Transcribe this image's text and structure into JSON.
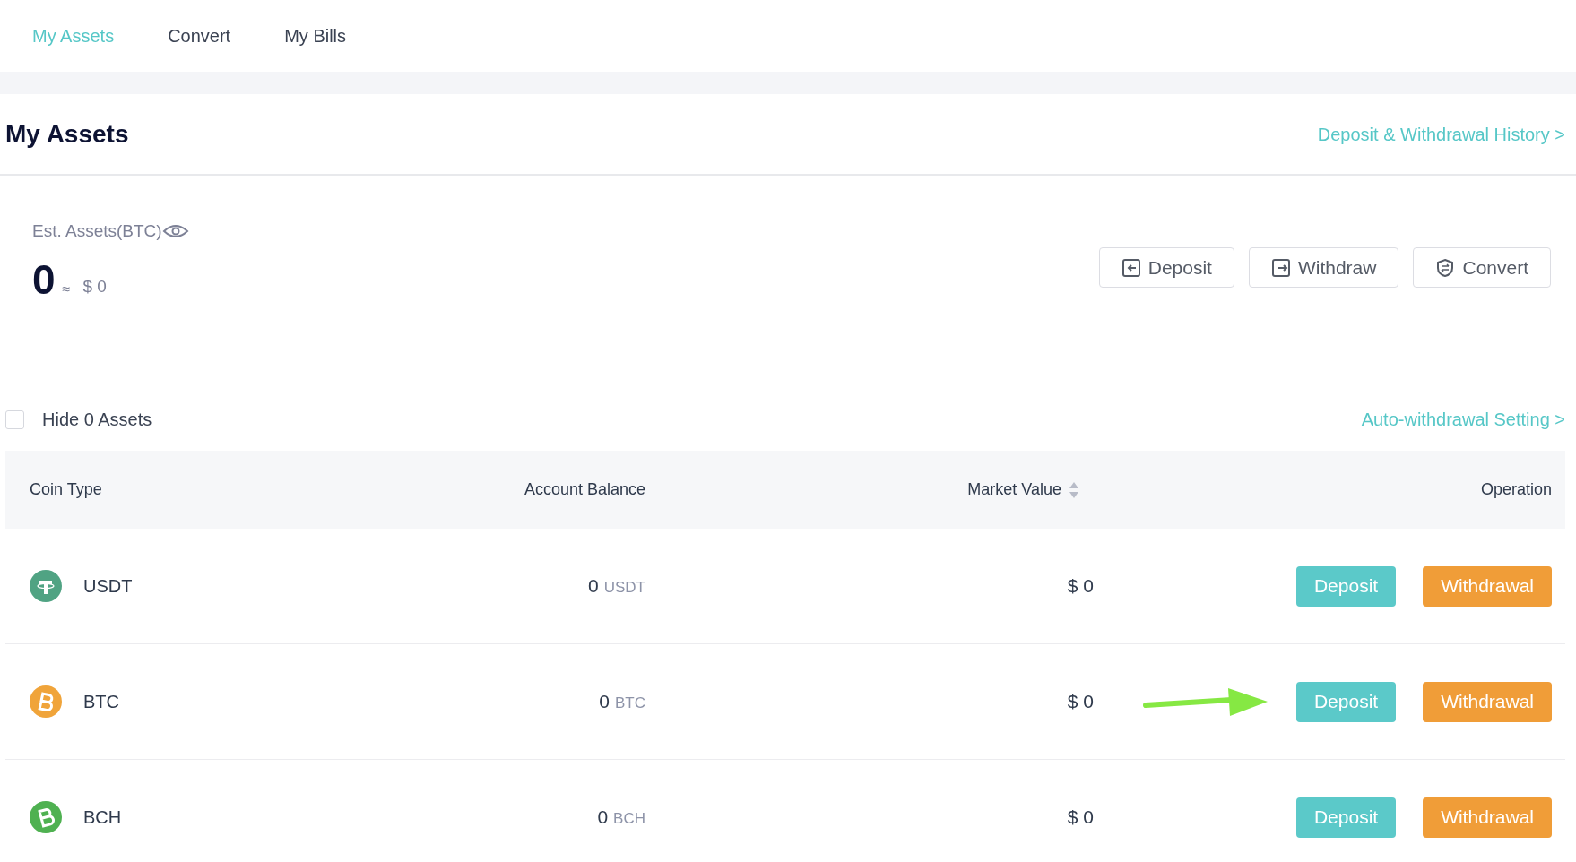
{
  "tabs": [
    {
      "label": "My Assets",
      "selected": true
    },
    {
      "label": "Convert",
      "selected": false
    },
    {
      "label": "My Bills",
      "selected": false
    }
  ],
  "page_title": "My Assets",
  "history_link": "Deposit & Withdrawal History >",
  "estimate": {
    "label": "Est. Assets(BTC)",
    "amount": "0",
    "approx": "≈",
    "fiat": "$ 0"
  },
  "actions": [
    {
      "label": "Deposit",
      "kind": "deposit"
    },
    {
      "label": "Withdraw",
      "kind": "withdraw"
    },
    {
      "label": "Convert",
      "kind": "convert"
    }
  ],
  "hide_zero": {
    "label": "Hide 0 Assets",
    "checked": false
  },
  "auto_withdrawal_link": "Auto-withdrawal Setting >",
  "table": {
    "columns": [
      {
        "label": "Coin Type",
        "sortable": false
      },
      {
        "label": "Account Balance",
        "sortable": false
      },
      {
        "label": "Market Value",
        "sortable": true
      },
      {
        "label": "Operation",
        "sortable": false
      }
    ],
    "rows": [
      {
        "coin": "USDT",
        "kind": "tether",
        "balance": "0",
        "unit": "USDT",
        "market_value": "$ 0",
        "pointer_arrow": false,
        "buttons": [
          {
            "label": "Deposit",
            "kind": "deposit"
          },
          {
            "label": "Withdrawal",
            "kind": "withdrawal"
          }
        ]
      },
      {
        "coin": "BTC",
        "kind": "bitcoin",
        "balance": "0",
        "unit": "BTC",
        "market_value": "$ 0",
        "pointer_arrow": true,
        "buttons": [
          {
            "label": "Deposit",
            "kind": "deposit"
          },
          {
            "label": "Withdrawal",
            "kind": "withdrawal"
          }
        ]
      },
      {
        "coin": "BCH",
        "kind": "bitcoin-cash",
        "balance": "0",
        "unit": "BCH",
        "market_value": "$ 0",
        "pointer_arrow": false,
        "buttons": [
          {
            "label": "Deposit",
            "kind": "deposit"
          },
          {
            "label": "Withdrawal",
            "kind": "withdrawal"
          }
        ]
      }
    ]
  }
}
